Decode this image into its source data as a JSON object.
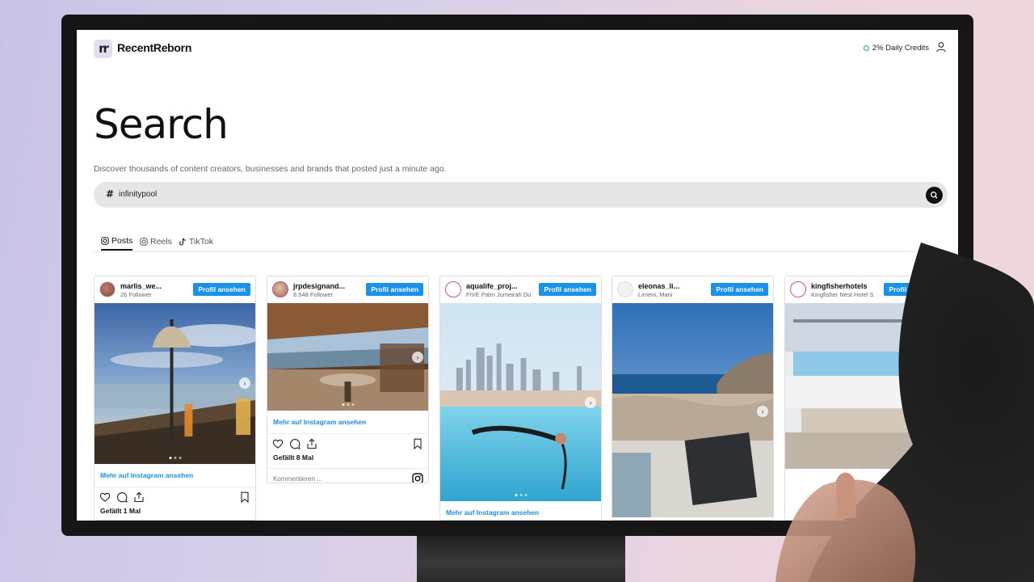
{
  "app": {
    "brand": "RecentReborn",
    "logo_text": "rr",
    "credits": "2% Daily Credits"
  },
  "page": {
    "title": "Search",
    "subtitle": "Discover thousands of content creators, businesses and brands that posted just a minute ago."
  },
  "search": {
    "prefix": "#",
    "value": "infinitypool"
  },
  "tabs": [
    {
      "label": "Posts",
      "icon": "instagram-icon",
      "active": true
    },
    {
      "label": "Reels",
      "icon": "instagram-icon",
      "active": false
    },
    {
      "label": "TikTok",
      "icon": "tiktok-icon",
      "active": false
    }
  ],
  "posts": [
    {
      "username": "marlis_we...",
      "sub": "26 Follower",
      "button": "Profil ansehen",
      "link": "Mehr auf Instagram ansehen",
      "likes": "Gefällt 1 Mal"
    },
    {
      "username": "jrpdesignand...",
      "sub": "8.548 Follower",
      "button": "Profil ansehen",
      "link": "Mehr auf Instagram ansehen",
      "likes": "Gefällt 8 Mal",
      "comment_placeholder": "Kommentieren ..."
    },
    {
      "username": "aqualife_proj...",
      "sub": "FIVE Palm Jumeirah Du",
      "button": "Profil ansehen",
      "link": "Mehr auf Instagram ansehen"
    },
    {
      "username": "eleonas_li...",
      "sub": "Limeni, Mani",
      "button": "Profil ansehen"
    },
    {
      "username": "kingfisherhotels",
      "sub": "Kingfisher Nest Hotel S",
      "button": "Profil ansehen"
    }
  ],
  "colors": {
    "accent": "#1a91ea",
    "credits_dot": "#2bb24c",
    "search_bg": "#e6e6e6"
  }
}
